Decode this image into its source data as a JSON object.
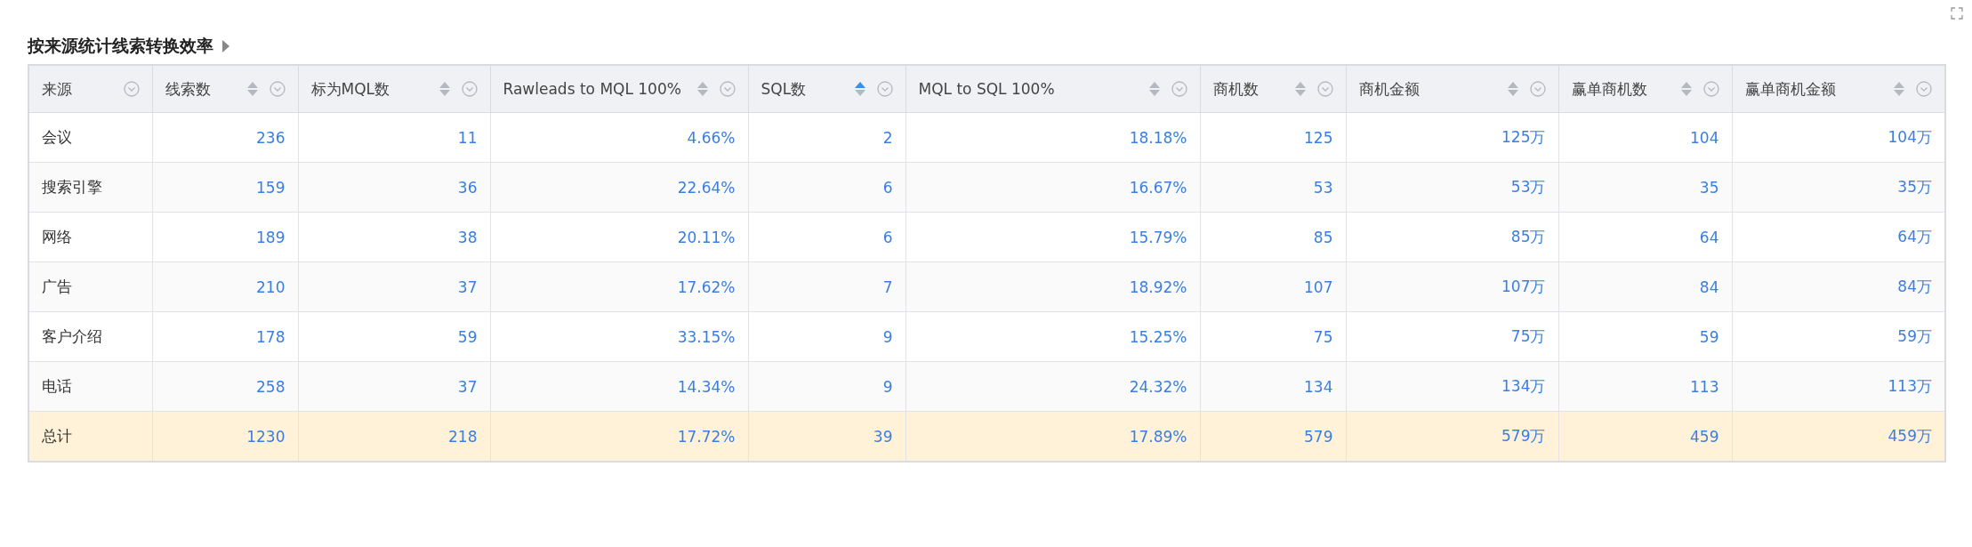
{
  "title": "按来源统计线索转换效率",
  "table": {
    "columns": [
      {
        "label": "来源",
        "sortable": false
      },
      {
        "label": "线索数",
        "sortable": true,
        "sorted_ascending": false
      },
      {
        "label": "标为MQL数",
        "sortable": true,
        "sorted_ascending": false
      },
      {
        "label": "Rawleads to MQL 100%",
        "sortable": true,
        "sorted_ascending": false
      },
      {
        "label": "SQL数",
        "sortable": true,
        "sorted_ascending": true
      },
      {
        "label": "MQL to SQL 100%",
        "sortable": true,
        "sorted_ascending": false
      },
      {
        "label": "商机数",
        "sortable": true,
        "sorted_ascending": false
      },
      {
        "label": "商机金额",
        "sortable": true,
        "sorted_ascending": false
      },
      {
        "label": "赢单商机数",
        "sortable": true,
        "sorted_ascending": false
      },
      {
        "label": "赢单商机金额",
        "sortable": true,
        "sorted_ascending": false
      }
    ],
    "rows": [
      {
        "kind": "data",
        "cells": [
          "会议",
          "236",
          "11",
          "4.66%",
          "2",
          "18.18%",
          "125",
          "125万",
          "104",
          "104万"
        ]
      },
      {
        "kind": "data",
        "cells": [
          "搜索引擎",
          "159",
          "36",
          "22.64%",
          "6",
          "16.67%",
          "53",
          "53万",
          "35",
          "35万"
        ]
      },
      {
        "kind": "data",
        "cells": [
          "网络",
          "189",
          "38",
          "20.11%",
          "6",
          "15.79%",
          "85",
          "85万",
          "64",
          "64万"
        ]
      },
      {
        "kind": "data",
        "cells": [
          "广告",
          "210",
          "37",
          "17.62%",
          "7",
          "18.92%",
          "107",
          "107万",
          "84",
          "84万"
        ]
      },
      {
        "kind": "data",
        "cells": [
          "客户介绍",
          "178",
          "59",
          "33.15%",
          "9",
          "15.25%",
          "75",
          "75万",
          "59",
          "59万"
        ]
      },
      {
        "kind": "data",
        "cells": [
          "电话",
          "258",
          "37",
          "14.34%",
          "9",
          "24.32%",
          "134",
          "134万",
          "113",
          "113万"
        ]
      },
      {
        "kind": "total",
        "cells": [
          "总计",
          "1230",
          "218",
          "17.72%",
          "39",
          "17.89%",
          "579",
          "579万",
          "459",
          "459万"
        ]
      }
    ]
  }
}
